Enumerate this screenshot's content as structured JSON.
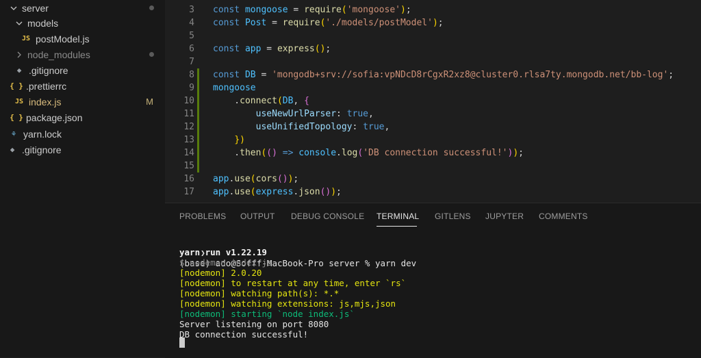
{
  "explorer": {
    "items": [
      {
        "label": "server",
        "type": "folder-open",
        "dot": true
      },
      {
        "label": "models",
        "type": "folder-open"
      },
      {
        "label": "postModel.js",
        "type": "js",
        "icon": "JS"
      },
      {
        "label": "node_modules",
        "type": "folder-closed",
        "dot": true
      },
      {
        "label": ".gitignore",
        "type": "git"
      },
      {
        "label": ".prettierrc",
        "type": "json",
        "icon": "{ }"
      },
      {
        "label": "index.js",
        "type": "js",
        "icon": "JS",
        "badge": "M"
      },
      {
        "label": "package.json",
        "type": "json",
        "icon": "{ }"
      },
      {
        "label": "yarn.lock",
        "type": "yarn"
      },
      {
        "label": ".gitignore",
        "type": "git"
      }
    ]
  },
  "editor": {
    "lines": [
      {
        "n": "3",
        "code": "const mongoose = require('mongoose');"
      },
      {
        "n": "4",
        "code": "const Post = require('./models/postModel');"
      },
      {
        "n": "5",
        "code": ""
      },
      {
        "n": "6",
        "code": "const app = express();"
      },
      {
        "n": "7",
        "code": ""
      },
      {
        "n": "8",
        "code": "const DB = 'mongodb+srv://sofia:vpNDcD8rCgxR2xz8@cluster0.rlsa7ty.mongodb.net/bb-log';"
      },
      {
        "n": "9",
        "code": "mongoose"
      },
      {
        "n": "10",
        "code": "    .connect(DB, {"
      },
      {
        "n": "11",
        "code": "        useNewUrlParser: true,"
      },
      {
        "n": "12",
        "code": "        useUnifiedTopology: true,"
      },
      {
        "n": "13",
        "code": "    })"
      },
      {
        "n": "14",
        "code": "    .then(() => console.log('DB connection successful!'));"
      },
      {
        "n": "15",
        "code": ""
      },
      {
        "n": "16",
        "code": "app.use(cors());"
      },
      {
        "n": "17",
        "code": "app.use(express.json());"
      }
    ]
  },
  "panel": {
    "tabs": [
      "PROBLEMS",
      "OUTPUT",
      "DEBUG CONSOLE",
      "TERMINAL",
      "GITLENS",
      "JUPYTER",
      "COMMENTS"
    ],
    "active_tab": "TERMINAL"
  },
  "terminal": {
    "prompt": "(base) ado@Sofff-MacBook-Pro server % yarn dev",
    "lines": [
      {
        "text": "yarn run v1.22.19",
        "style": "bold"
      },
      {
        "text": "$ nodemon index.js",
        "style": "gray"
      },
      {
        "text": "[nodemon] 2.0.20",
        "style": "yellow"
      },
      {
        "text": "[nodemon] to restart at any time, enter `rs`",
        "style": "yellow"
      },
      {
        "text": "[nodemon] watching path(s): *.*",
        "style": "yellow"
      },
      {
        "text": "[nodemon] watching extensions: js,mjs,json",
        "style": "yellow"
      },
      {
        "text": "[nodemon] starting `node index.js`",
        "style": "green"
      },
      {
        "text": "Server listening on port 8080",
        "style": "plain"
      },
      {
        "text": "DB connection successful!",
        "style": "plain"
      }
    ]
  },
  "colors": {
    "background": "#1e1e1e",
    "sidebar": "#181818",
    "accent_modified": "#587c0c",
    "terminal_yellow": "#e5e510",
    "terminal_green": "#0dbc79"
  }
}
